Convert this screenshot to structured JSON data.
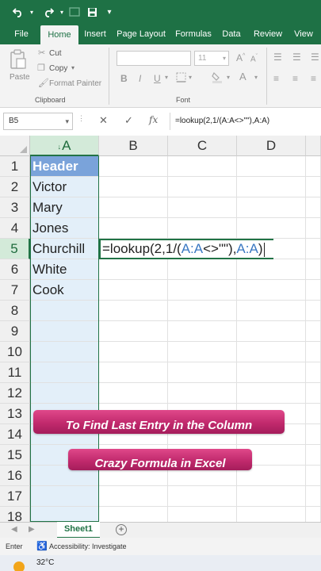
{
  "quick_access": {
    "undo_icon": "undo-icon",
    "redo_icon": "redo-icon",
    "save_icon": "save-icon"
  },
  "ribbon_tabs": [
    "File",
    "Home",
    "Insert",
    "Page Layout",
    "Formulas",
    "Data",
    "Review",
    "View"
  ],
  "ribbon": {
    "cut": "Cut",
    "copy": "Copy",
    "paste": "Paste",
    "format_painter": "Format Painter",
    "clipboard_group": "Clipboard",
    "font_size": "11",
    "font_group": "Font"
  },
  "formula_bar": {
    "name_box": "B5",
    "fx": "fx",
    "formula": "=lookup(2,1/(A:A<>\"\"),A:A)"
  },
  "grid": {
    "columns": [
      "A",
      "B",
      "C",
      "D"
    ],
    "rows": [
      "1",
      "2",
      "3",
      "4",
      "5",
      "6",
      "7",
      "8",
      "9",
      "10",
      "11",
      "12",
      "13",
      "14",
      "15",
      "16",
      "17",
      "18"
    ],
    "column_a_values": [
      "Header",
      "Victor",
      "Mary",
      "Jones",
      "Churchill",
      "White",
      "Cook"
    ],
    "editing_cell": {
      "part1": "=lookup(2,1/(",
      "ref1": "A:A",
      "part2": "<>\"\"),",
      "ref2": "A:A",
      "part3": ")"
    }
  },
  "banners": {
    "line1": "To Find Last Entry in the Column",
    "line2": "Crazy Formula in Excel"
  },
  "sheet_tabs": {
    "active": "Sheet1"
  },
  "status_bar": {
    "mode": "Enter",
    "accessibility": "Accessibility: Investigate"
  },
  "taskbar": {
    "temperature": "32°C"
  },
  "colors": {
    "brand_green": "#1e7145",
    "header_cell_blue": "#7aa3da",
    "column_select": "#e3eff9",
    "banner_pink": "#c12a6d"
  }
}
